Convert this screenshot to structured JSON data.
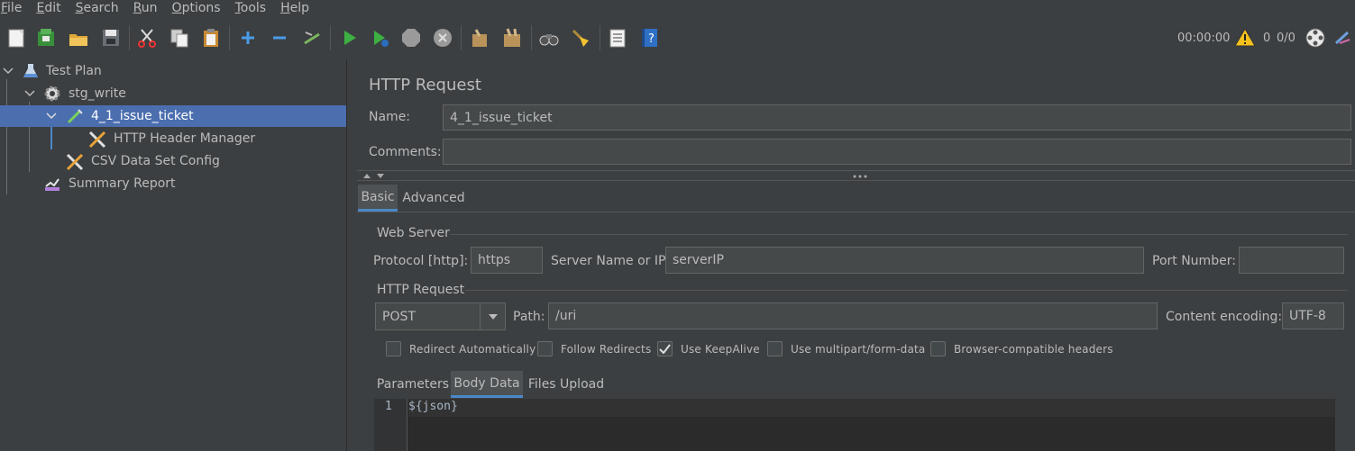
{
  "menu": [
    {
      "label": "File",
      "mnemonic": "F",
      "rest": "ile"
    },
    {
      "label": "Edit",
      "mnemonic": "E",
      "rest": "dit"
    },
    {
      "label": "Search",
      "mnemonic": "S",
      "rest": "earch"
    },
    {
      "label": "Run",
      "mnemonic": "R",
      "rest": "un"
    },
    {
      "label": "Options",
      "mnemonic": "O",
      "rest": "ptions"
    },
    {
      "label": "Tools",
      "mnemonic": "T",
      "rest": "ools"
    },
    {
      "label": "Help",
      "mnemonic": "H",
      "rest": "elp"
    }
  ],
  "status": {
    "elapsed": "00:00:00",
    "warnings": "0",
    "threads": "0/0"
  },
  "tree": {
    "test_plan": "Test Plan",
    "thread_group": "stg_write",
    "sampler": "4_1_issue_ticket",
    "header_manager": "HTTP Header Manager",
    "csv_config": "CSV Data Set Config",
    "summary_report": "Summary Report"
  },
  "panel": {
    "title": "HTTP Request",
    "name_label": "Name:",
    "name_value": "4_1_issue_ticket",
    "comments_label": "Comments:",
    "comments_value": ""
  },
  "tabs": {
    "basic": "Basic",
    "advanced": "Advanced"
  },
  "web_server": {
    "group_title": "Web Server",
    "protocol_label": "Protocol [http]:",
    "protocol_value": "https",
    "server_label": "Server Name or IP:",
    "server_value": "serverIP",
    "port_label": "Port Number:",
    "port_value": ""
  },
  "http_request": {
    "group_title": "HTTP Request",
    "method": "POST",
    "path_label": "Path:",
    "path_value": "/uri",
    "encoding_label": "Content encoding:",
    "encoding_value": "UTF-8"
  },
  "options": {
    "redirect_auto": {
      "label": "Redirect Automatically",
      "checked": false
    },
    "follow_redirects": {
      "label": "Follow Redirects",
      "checked": false
    },
    "keepalive": {
      "label": "Use KeepAlive",
      "checked": true
    },
    "multipart": {
      "label": "Use multipart/form-data",
      "checked": false
    },
    "browser_headers": {
      "label": "Browser-compatible headers",
      "checked": false
    }
  },
  "sub_tabs": {
    "parameters": "Parameters",
    "body_data": "Body Data",
    "files_upload": "Files Upload"
  },
  "editor": {
    "line_number": "1",
    "line_text": "${json}"
  }
}
